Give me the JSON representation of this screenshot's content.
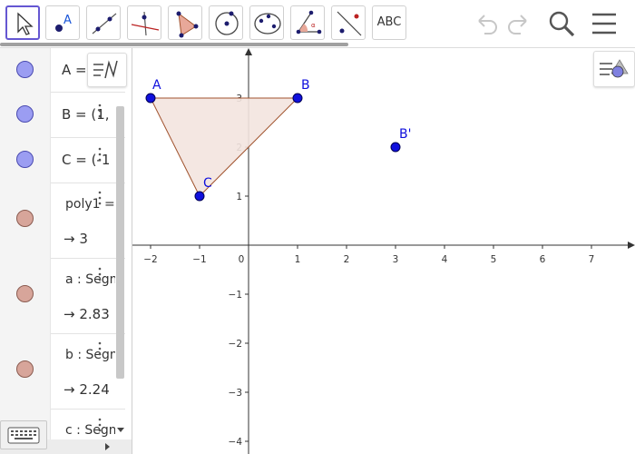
{
  "toolbar": {
    "tools": [
      {
        "name": "move-tool"
      },
      {
        "name": "point-tool"
      },
      {
        "name": "line-tool"
      },
      {
        "name": "perpendicular-line-tool"
      },
      {
        "name": "polygon-tool"
      },
      {
        "name": "circle-center-point-tool"
      },
      {
        "name": "conic-tool"
      },
      {
        "name": "angle-tool"
      },
      {
        "name": "reflect-line-tool"
      },
      {
        "name": "text-tool",
        "label": "ABC"
      }
    ],
    "selected_tool": "move-tool"
  },
  "algebra": {
    "rows": [
      {
        "name": "A",
        "definition": "A = (",
        "marble": "point"
      },
      {
        "name": "B",
        "definition": "B = (1,",
        "marble": "point"
      },
      {
        "name": "C",
        "definition": "C = (-1",
        "marble": "point"
      },
      {
        "name": "poly1",
        "definition": "poly1 =",
        "value": "→  3",
        "marble": "shape"
      },
      {
        "name": "a",
        "definition": "a : Segm",
        "value": "→  2.83",
        "marble": "shape"
      },
      {
        "name": "b",
        "definition": "b : Segm",
        "value": "→  2.24",
        "marble": "shape"
      },
      {
        "name": "c",
        "definition": "c : Segm",
        "marble": "shape"
      }
    ]
  },
  "graphics": {
    "points": [
      {
        "label": "A",
        "x": -2,
        "y": 3
      },
      {
        "label": "B",
        "x": 1,
        "y": 3
      },
      {
        "label": "C",
        "x": -1,
        "y": 1
      },
      {
        "label": "B'",
        "x": 3,
        "y": 2
      }
    ],
    "polygon": [
      "A",
      "B",
      "C"
    ],
    "x_ticks": [
      "−2",
      "−1",
      "0",
      "1",
      "2",
      "3",
      "4",
      "5",
      "6",
      "7"
    ],
    "y_ticks": [
      "3",
      "2",
      "1",
      "−1",
      "−2",
      "−3",
      "−4"
    ],
    "colors": {
      "point": "#1010dd",
      "polygon_fill": "#f3e4df",
      "polygon_edge": "#a0522d"
    }
  }
}
